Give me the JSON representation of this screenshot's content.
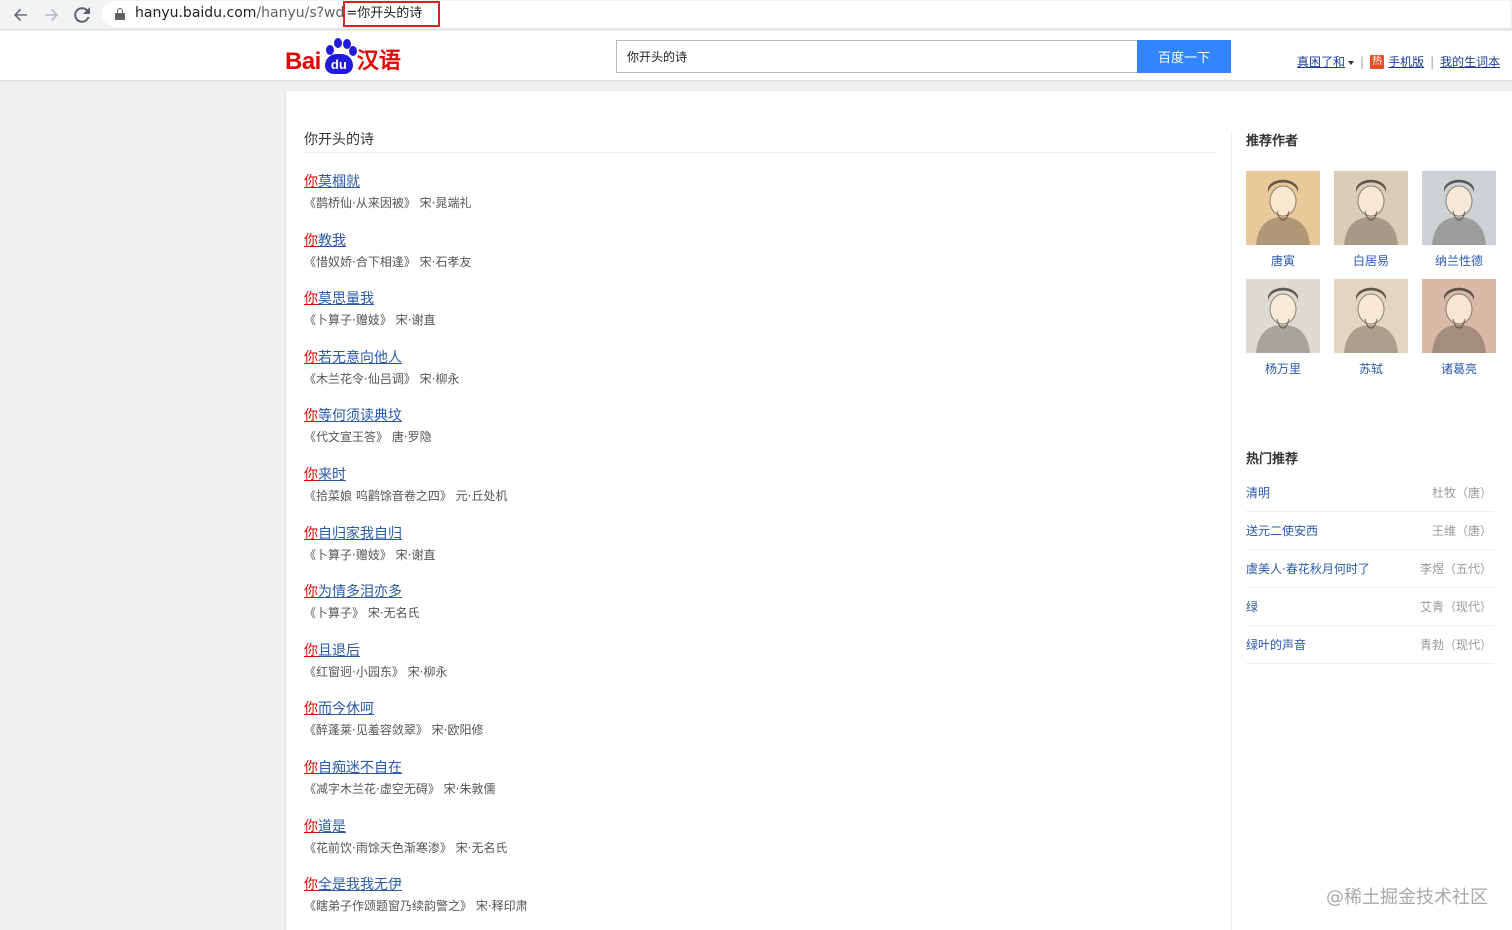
{
  "browser": {
    "url_host": "hanyu.baidu.com",
    "url_path": "/hanyu/s?wd",
    "url_query": "=你开头的诗"
  },
  "header": {
    "logo_left": "Bai",
    "logo_paw": "du",
    "logo_right": "汉语",
    "search_value": "你开头的诗",
    "search_button": "百度一下",
    "links": [
      "真困了和",
      "手机版",
      "我的生词本"
    ],
    "hot_badge": "热"
  },
  "main": {
    "query_title": "你开头的诗",
    "results": [
      {
        "first": "你",
        "rest": "莫椢就",
        "source": "《鹊桥仙·从来因被》 宋·晁端礼"
      },
      {
        "first": "你",
        "rest": "教我",
        "source": "《惜奴娇·合下相逢》 宋·石孝友"
      },
      {
        "first": "你",
        "rest": "莫思量我",
        "source": "《卜算子·赠妓》 宋·谢直"
      },
      {
        "first": "你",
        "rest": "若无意向他人",
        "source": "《木兰花令·仙吕调》 宋·柳永"
      },
      {
        "first": "你",
        "rest": "等何须读典坟",
        "source": "《代文宣王答》 唐·罗隐"
      },
      {
        "first": "你",
        "rest": "来时",
        "source": "《拾菜娘 呜鹳馀音卷之四》 元·丘处机"
      },
      {
        "first": "你",
        "rest": "自归家我自归",
        "source": "《卜算子·赠妓》 宋·谢直"
      },
      {
        "first": "你",
        "rest": "为情多泪亦多",
        "source": "《卜算子》 宋·无名氏"
      },
      {
        "first": "你",
        "rest": "且退后",
        "source": "《红窗迥·小园东》 宋·柳永"
      },
      {
        "first": "你",
        "rest": "而今休呵",
        "source": "《醉蓬莱·见羞容敛翠》 宋·欧阳修"
      },
      {
        "first": "你",
        "rest": "自痴迷不自在",
        "source": "《减字木兰花·虚空无碍》 宋·朱敦儒"
      },
      {
        "first": "你",
        "rest": "道是",
        "source": "《花前饮·雨馀天色渐寒渗》 宋·无名氏"
      },
      {
        "first": "你",
        "rest": "全是我我无伊",
        "source": "《瞎弟子作颂题窗乃续韵警之》 宋·释印肃"
      }
    ]
  },
  "sidebar": {
    "authors_heading": "推荐作者",
    "authors": [
      {
        "name": "唐寅",
        "bg": "#e9c99a"
      },
      {
        "name": "白居易",
        "bg": "#d9cdb7"
      },
      {
        "name": "纳兰性德",
        "bg": "#cdd3d4"
      },
      {
        "name": "杨万里",
        "bg": "#dedad4"
      },
      {
        "name": "苏轼",
        "bg": "#e2d6c0"
      },
      {
        "name": "诸葛亮",
        "bg": "#d9b9a8"
      }
    ],
    "hot_heading": "热门推荐",
    "hot": [
      {
        "title": "清明",
        "author": "杜牧（唐）"
      },
      {
        "title": "送元二使安西",
        "author": "王维（唐）"
      },
      {
        "title": "虞美人·春花秋月何时了",
        "author": "李煜（五代）"
      },
      {
        "title": "绿",
        "author": "艾青（现代）"
      },
      {
        "title": "绿叶的声音",
        "author": "青勃（现代）"
      }
    ]
  },
  "watermark": "@稀土掘金技术社区",
  "colors": {
    "brand_red": "#e10601",
    "brand_blue": "#2319dc",
    "button_blue": "#3385ff",
    "link_blue": "#2b5aa8"
  }
}
